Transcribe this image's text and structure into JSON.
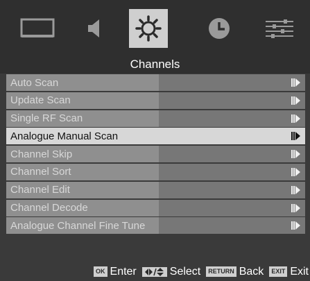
{
  "tabs": [
    {
      "name": "picture",
      "icon": "tv-screen-icon",
      "active": false
    },
    {
      "name": "sound",
      "icon": "speaker-icon",
      "active": false
    },
    {
      "name": "setup",
      "icon": "gear-icon",
      "active": true
    },
    {
      "name": "time",
      "icon": "clock-icon",
      "active": false
    },
    {
      "name": "options",
      "icon": "sliders-icon",
      "active": false
    }
  ],
  "header": {
    "title": "Channels"
  },
  "menu": {
    "items": [
      {
        "label": "Auto Scan"
      },
      {
        "label": "Update Scan"
      },
      {
        "label": "Single RF Scan"
      },
      {
        "label": "Analogue Manual Scan",
        "selected": true
      },
      {
        "label": "Channel Skip"
      },
      {
        "label": "Channel Sort"
      },
      {
        "label": "Channel Edit"
      },
      {
        "label": "Channel Decode"
      },
      {
        "label": "Analogue Channel Fine Tune"
      }
    ]
  },
  "footer": {
    "ok_key": "OK",
    "ok_label": "Enter",
    "select_label": "Select",
    "return_key": "RETURN",
    "return_label": "Back",
    "exit_key": "EXIT",
    "exit_label": "Exit"
  },
  "colors": {
    "background": "#3a3a3a",
    "active_tab": "#cfcfcf",
    "selected_row": "#d7d7d7",
    "row_left": "#8f8f8f",
    "row_right": "#777777"
  }
}
